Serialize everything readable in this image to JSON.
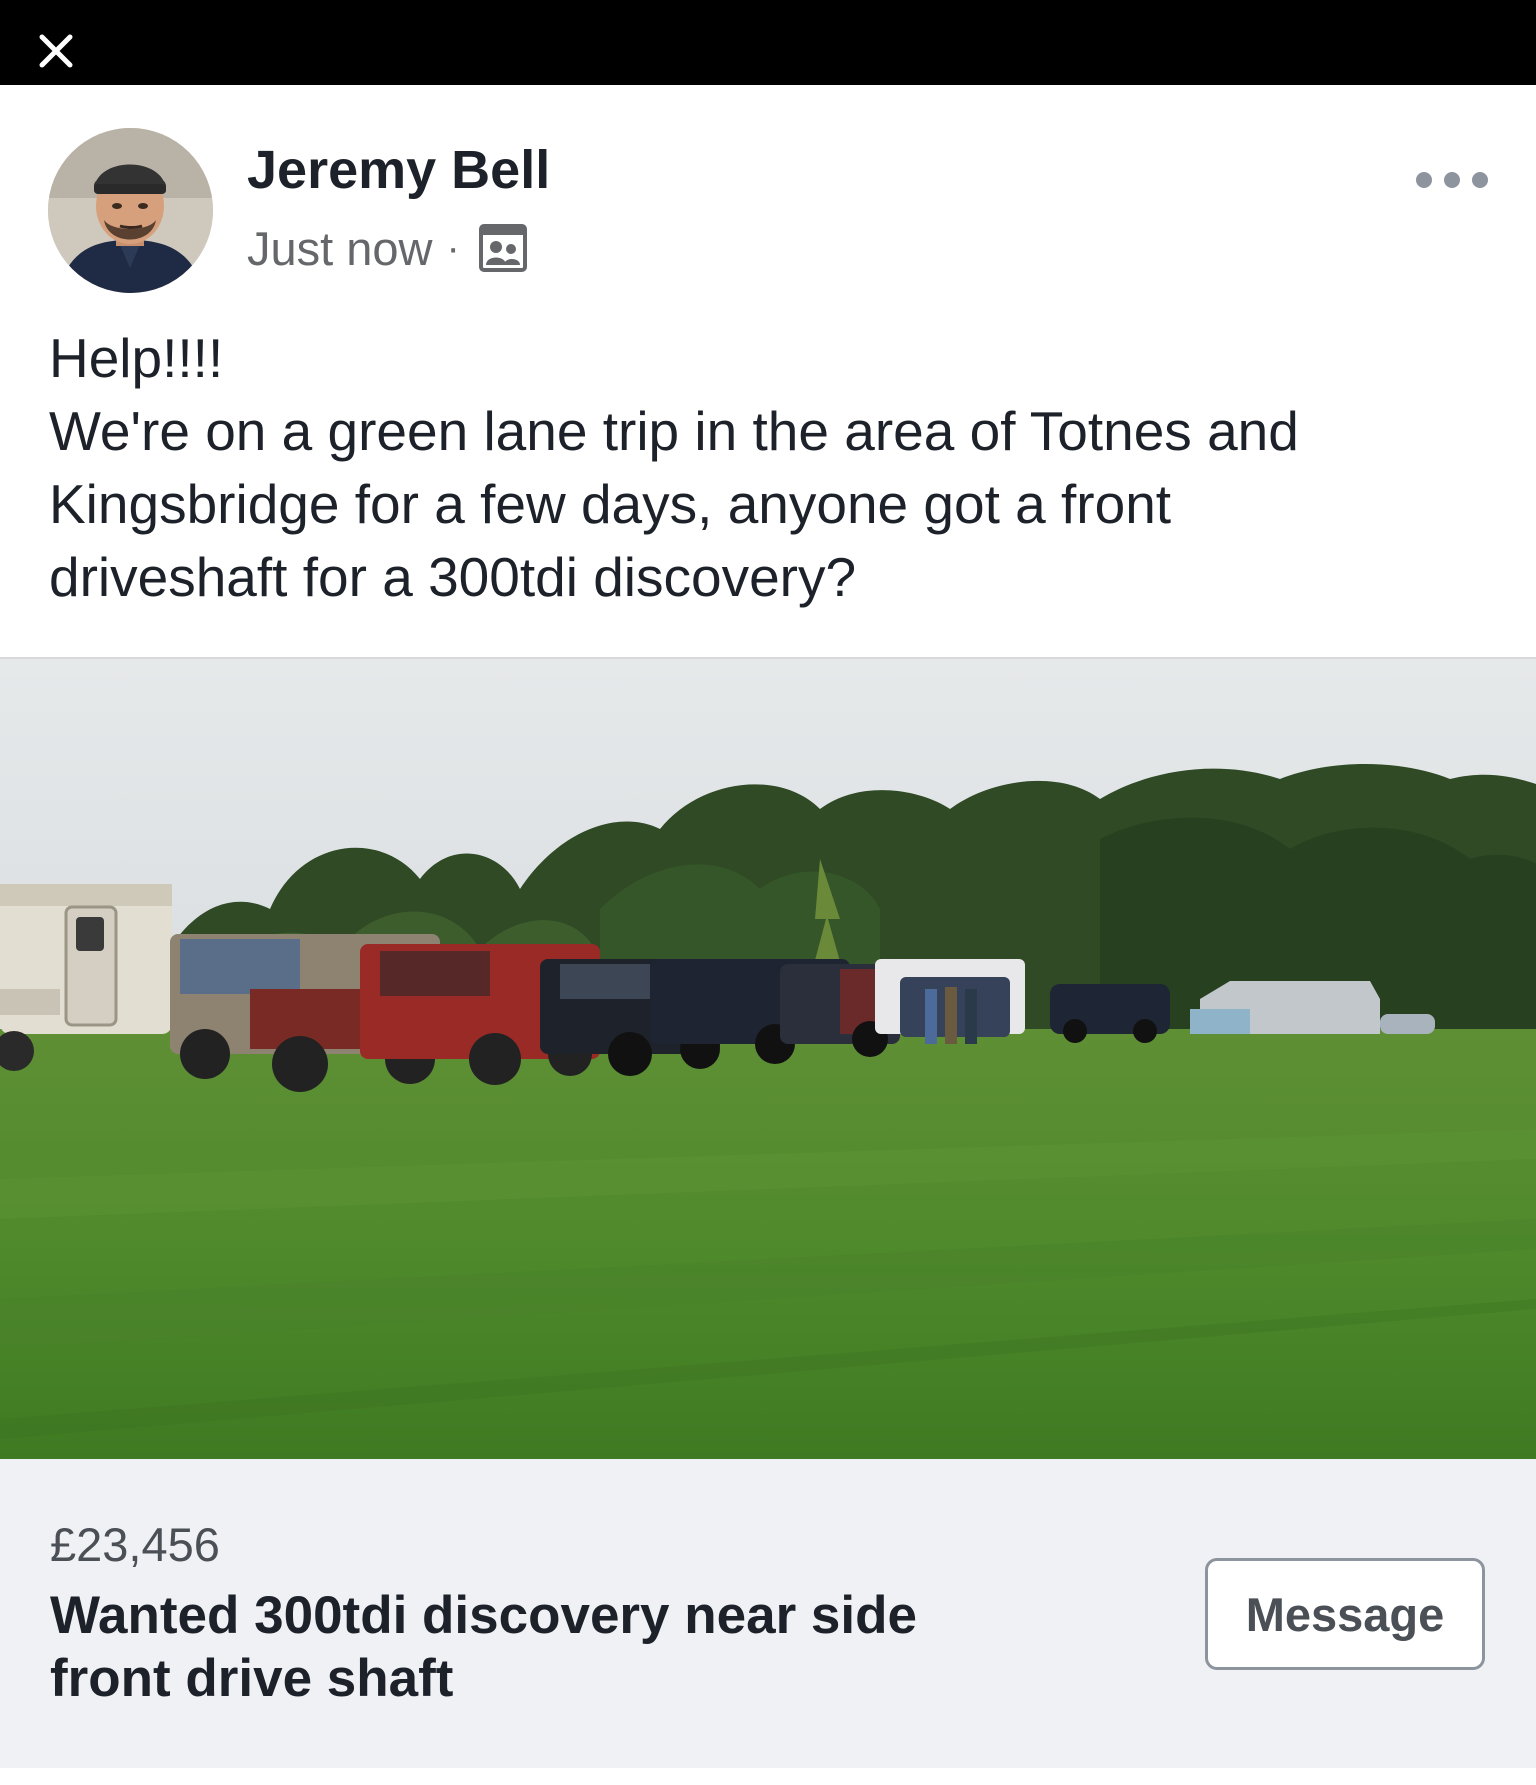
{
  "header": {
    "author_name": "Jeremy Bell",
    "timestamp": "Just now",
    "separator": "·",
    "audience_icon": "group-icon",
    "more_icon": "more-options-icon",
    "close_icon": "close-icon"
  },
  "post": {
    "lines": [
      "Help!!!!",
      "We're on a green lane trip in the area of Totnes and",
      "Kingsbridge for a few days, anyone got a front",
      "driveshaft for a 300tdi discovery?"
    ]
  },
  "listing": {
    "price": "£23,456",
    "title_lines": [
      "Wanted 300tdi discovery near side",
      "front drive shaft"
    ],
    "message_label": "Message"
  },
  "colors": {
    "top_bar": "#000000",
    "text_primary": "#1d2129",
    "text_secondary": "#65676b",
    "listing_background": "#f0f1f4"
  }
}
